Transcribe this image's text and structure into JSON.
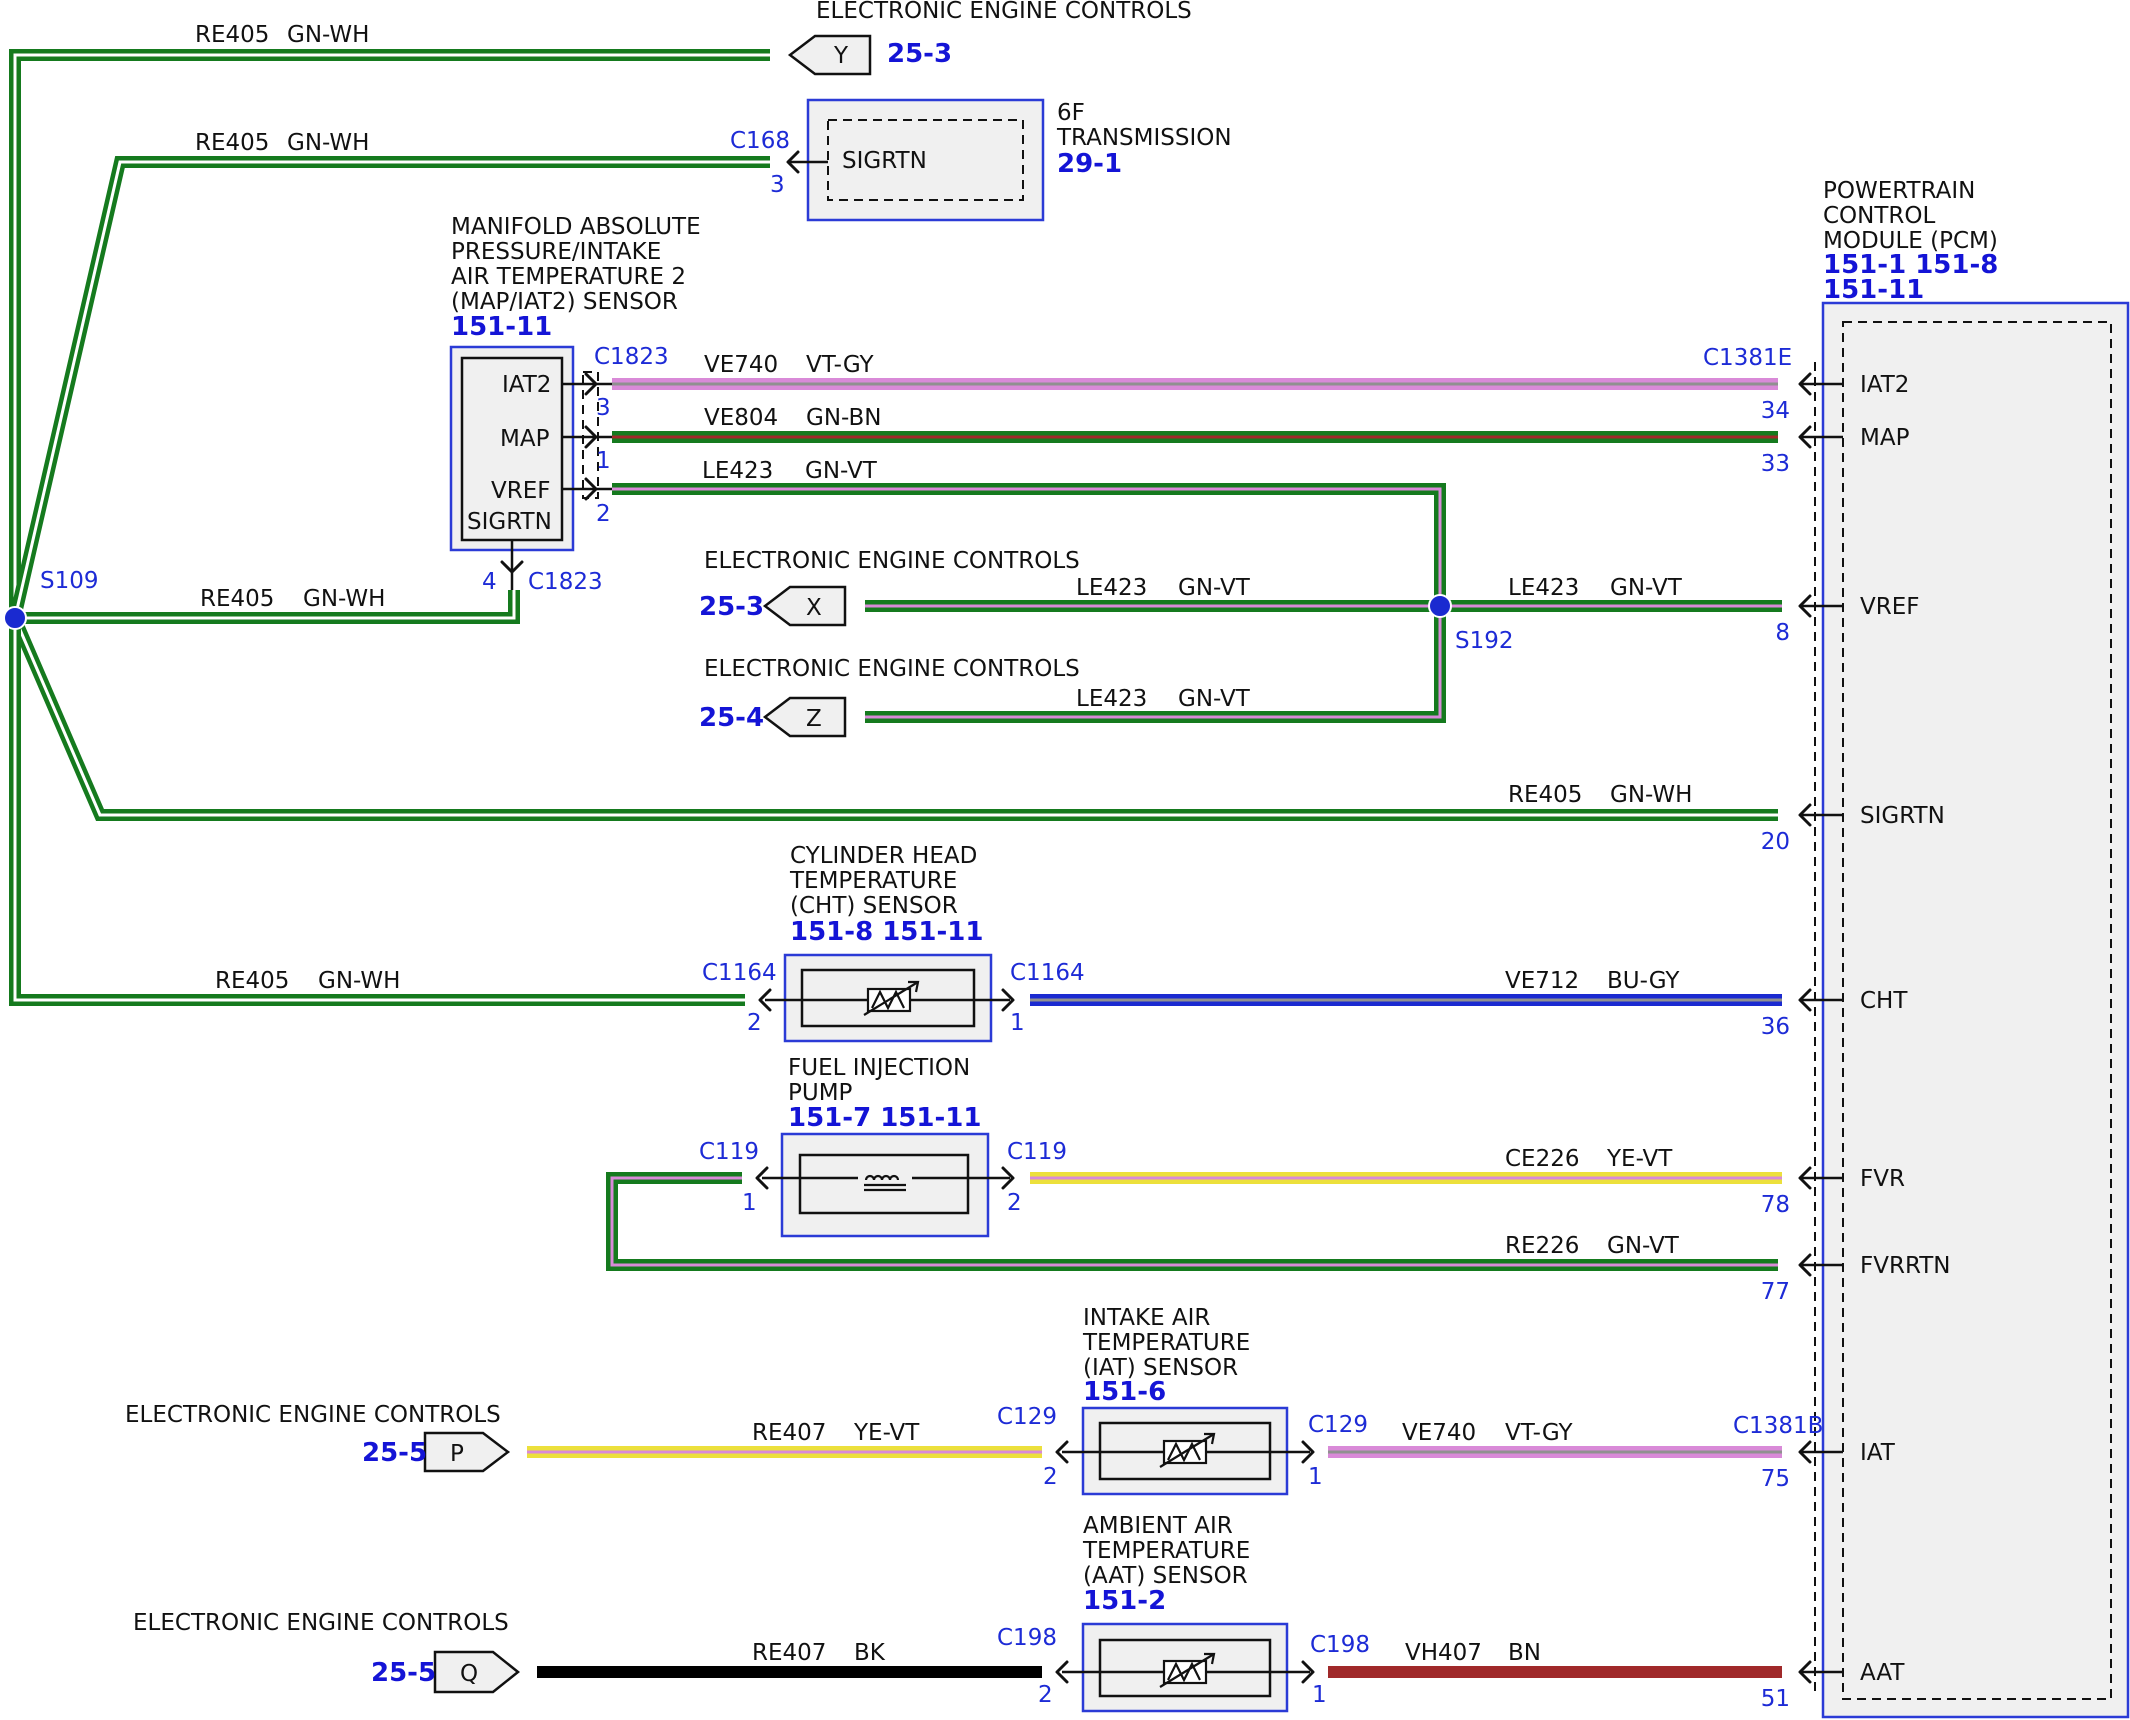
{
  "colors": {
    "GN": "#157a1e",
    "WH": "#ffffff",
    "VT": "#d98ad8",
    "GY": "#909090",
    "BN": "#a0292a",
    "BU": "#1a2ad0",
    "YE": "#ece03c",
    "BK": "#000000",
    "connector_blue": "#1d2bd6"
  },
  "components": {
    "eec_y": {
      "title": "ELECTRONIC ENGINE CONTROLS",
      "tag": "Y",
      "ref": "25-3"
    },
    "trans": {
      "title1": "6F",
      "title2": "TRANSMISSION",
      "ref": "29-1",
      "connector": "C168",
      "pin": "3",
      "pin_label": "SIGRTN"
    },
    "map": {
      "title1": "MANIFOLD ABSOLUTE",
      "title2": "PRESSURE/INTAKE",
      "title3": "AIR TEMPERATURE 2",
      "title4": "(MAP/IAT2) SENSOR",
      "ref": "151-11",
      "pins": [
        "IAT2",
        "MAP",
        "VREF",
        "SIGRTN"
      ],
      "connector": "C1823",
      "pin_nums": [
        "3",
        "1",
        "2",
        "4"
      ]
    },
    "pcm": {
      "title1": "POWERTRAIN",
      "title2": "CONTROL",
      "title3": "MODULE (PCM)",
      "ref1": "151-1 151-8",
      "ref2": "151-11",
      "connector_e": "C1381E",
      "connector_b": "C1381B",
      "pins": [
        {
          "label": "IAT2",
          "num": "34"
        },
        {
          "label": "MAP",
          "num": "33"
        },
        {
          "label": "VREF",
          "num": "8"
        },
        {
          "label": "SIGRTN",
          "num": "20"
        },
        {
          "label": "CHT",
          "num": "36"
        },
        {
          "label": "FVR",
          "num": "78"
        },
        {
          "label": "FVRRTN",
          "num": "77"
        },
        {
          "label": "IAT",
          "num": "75"
        },
        {
          "label": "AAT",
          "num": "51"
        }
      ]
    },
    "eec_x": {
      "title": "ELECTRONIC ENGINE CONTROLS",
      "tag": "X",
      "ref": "25-3"
    },
    "eec_z": {
      "title": "ELECTRONIC ENGINE CONTROLS",
      "tag": "Z",
      "ref": "25-4"
    },
    "cht": {
      "title1": "CYLINDER HEAD",
      "title2": "TEMPERATURE",
      "title3": "(CHT) SENSOR",
      "ref": "151-8  151-11",
      "conn_left": "C1164",
      "pin_left": "2",
      "conn_right": "C1164",
      "pin_right": "1"
    },
    "fip": {
      "title1": "FUEL INJECTION",
      "title2": "PUMP",
      "ref": "151-7  151-11",
      "conn_left": "C119",
      "pin_left": "1",
      "conn_right": "C119",
      "pin_right": "2"
    },
    "iat": {
      "title1": "INTAKE AIR",
      "title2": "TEMPERATURE",
      "title3": "(IAT) SENSOR",
      "ref": "151-6",
      "conn_left": "C129",
      "pin_left": "2",
      "conn_right": "C129",
      "pin_right": "1"
    },
    "aat": {
      "title1": "AMBIENT AIR",
      "title2": "TEMPERATURE",
      "title3": "(AAT) SENSOR",
      "ref": "151-2",
      "conn_left": "C198",
      "pin_left": "2",
      "conn_right": "C198",
      "pin_right": "1"
    },
    "eec_p": {
      "title": "ELECTRONIC ENGINE CONTROLS",
      "tag": "P",
      "ref": "25-5"
    },
    "eec_q": {
      "title": "ELECTRONIC ENGINE CONTROLS",
      "tag": "Q",
      "ref": "25-5"
    }
  },
  "splices": {
    "s109": "S109",
    "s192": "S192"
  },
  "wires": {
    "re405": {
      "circuit": "RE405",
      "color": "GN-WH"
    },
    "ve740": {
      "circuit": "VE740",
      "color": "VT-GY"
    },
    "ve804": {
      "circuit": "VE804",
      "color": "GN-BN"
    },
    "le423": {
      "circuit": "LE423",
      "color": "GN-VT"
    },
    "ve712": {
      "circuit": "VE712",
      "color": "BU-GY"
    },
    "ce226": {
      "circuit": "CE226",
      "color": "YE-VT"
    },
    "re226": {
      "circuit": "RE226",
      "color": "GN-VT"
    },
    "re407_ye": {
      "circuit": "RE407",
      "color": "YE-VT"
    },
    "re407_bk": {
      "circuit": "RE407",
      "color": "BK"
    },
    "vh407": {
      "circuit": "VH407",
      "color": "BN"
    }
  }
}
